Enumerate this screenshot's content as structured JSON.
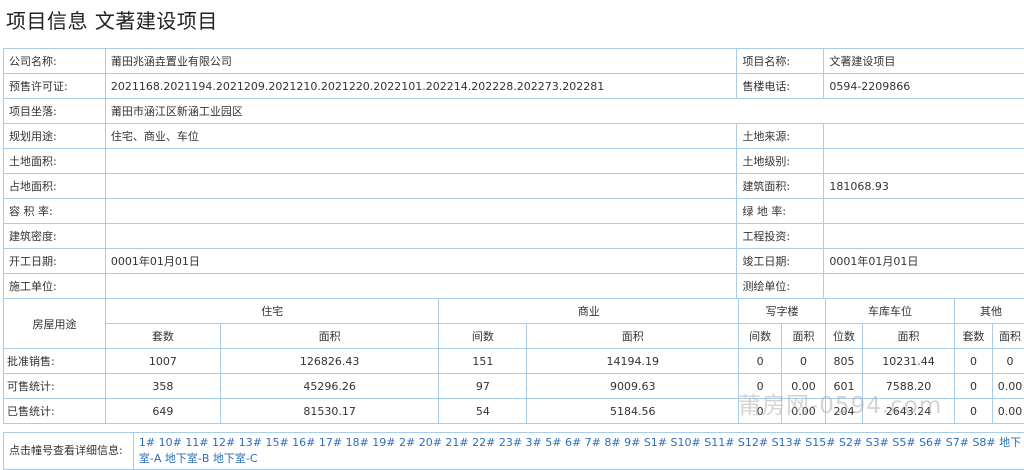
{
  "page_title": "项目信息 文著建设项目",
  "info": {
    "company_label": "公司名称:",
    "company": "莆田兆涵垚置业有限公司",
    "project_label": "项目名称:",
    "project": "文著建设项目",
    "permit_label": "预售许可证:",
    "permit": "2021168.2021194.2021209.2021210.2021220.2022101.202214.202228.202273.202281",
    "phone_label": "售楼电话:",
    "phone": "0594-2209866",
    "location_label": "项目坐落:",
    "location": "莆田市涵江区新涵工业园区",
    "usage_label": "规划用途:",
    "usage": "住宅、商业、车位",
    "land_source_label": "土地来源:",
    "land_source": "",
    "land_area_label": "土地面积:",
    "land_area": "",
    "land_grade_label": "土地级别:",
    "land_grade": "",
    "occupied_area_label": "占地面积:",
    "occupied_area": "",
    "building_area_label": "建筑面积:",
    "building_area": "181068.93",
    "plot_ratio_label": "容 积 率:",
    "plot_ratio": "",
    "green_ratio_label": "绿 地 率:",
    "green_ratio": "",
    "density_label": "建筑密度:",
    "density": "",
    "investment_label": "工程投资:",
    "investment": "",
    "start_label": "开工日期:",
    "start": "0001年01月01日",
    "complete_label": "竣工日期:",
    "complete": "0001年01月01日",
    "constructor_label": "施工单位:",
    "constructor": "",
    "surveyor_label": "测绘单位:",
    "surveyor": ""
  },
  "stats": {
    "house_usage": "房屋用途",
    "groups": [
      "住宅",
      "商业",
      "写字楼",
      "车库车位",
      "其他"
    ],
    "sub": [
      "套数",
      "面积",
      "间数",
      "面积",
      "间数",
      "面积",
      "位数",
      "面积",
      "套数",
      "面积"
    ],
    "rows": [
      {
        "label": "批准销售:",
        "cells": [
          "1007",
          "126826.43",
          "151",
          "14194.19",
          "0",
          "0",
          "805",
          "10231.44",
          "0",
          "0"
        ]
      },
      {
        "label": "可售统计:",
        "cells": [
          "358",
          "45296.26",
          "97",
          "9009.63",
          "0",
          "0.00",
          "601",
          "7588.20",
          "0",
          "0.00"
        ]
      },
      {
        "label": "已售统计:",
        "cells": [
          "649",
          "81530.17",
          "54",
          "5184.56",
          "0",
          "0.00",
          "204",
          "2643.24",
          "0",
          "0.00"
        ]
      }
    ]
  },
  "buildings": {
    "label": "点击幢号查看详细信息:",
    "links": "1# 10# 11# 12# 13# 15# 16# 17# 18# 19# 2# 20# 21# 22# 23# 3# 5# 6# 7# 8# 9# S1# S10# S11# S12# S13# S15# S2# S3# S5# S6# S7# S8# 地下室-A 地下室-B 地下室-C"
  },
  "watermark": "莆房网-0594.com"
}
